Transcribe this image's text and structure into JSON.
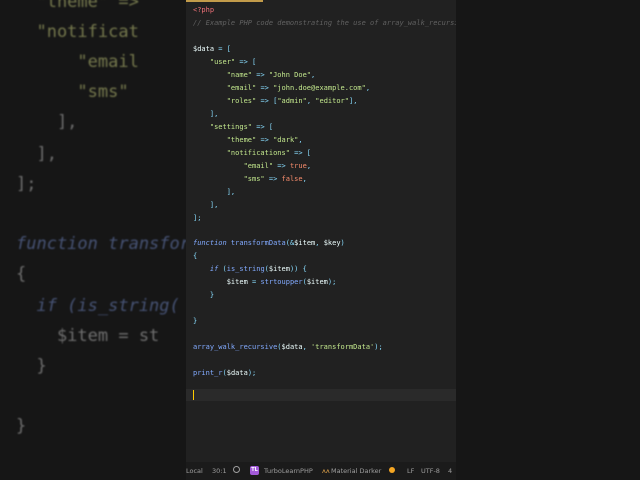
{
  "background_code": [
    {
      "text": "  \"theme\" =>",
      "cls": "bgstr"
    },
    {
      "text": "  \"notificat",
      "cls": "bgstr"
    },
    {
      "text": "      \"email",
      "cls": "bgstr"
    },
    {
      "text": "      \"sms\"",
      "cls": "bgstr"
    },
    {
      "text": "    ],",
      "cls": "bgpl"
    },
    {
      "text": "  ],",
      "cls": "bgpl"
    },
    {
      "text": "];",
      "cls": "bgpl"
    },
    {
      "text": "function transform",
      "cls": "bgkw"
    },
    {
      "text": "{",
      "cls": "bgpl"
    },
    {
      "text": "  if (is_string(",
      "cls": "bgkw"
    },
    {
      "text": "    $item = st",
      "cls": "bgvar"
    },
    {
      "text": "  }",
      "cls": "bgpl"
    },
    {
      "text": "}",
      "cls": "bgpl"
    }
  ],
  "editor": {
    "lines": [
      [
        {
          "t": "<?php",
          "c": "tag"
        }
      ],
      [
        {
          "t": "// Example PHP code demonstrating the use of array_walk_recursive",
          "c": "c"
        }
      ],
      [],
      [
        {
          "t": "$data",
          "c": "v"
        },
        {
          "t": " = [",
          "c": "p"
        }
      ],
      [
        {
          "t": "    ",
          "c": "v"
        },
        {
          "t": "\"user\"",
          "c": "s"
        },
        {
          "t": " => [",
          "c": "p"
        }
      ],
      [
        {
          "t": "        ",
          "c": "v"
        },
        {
          "t": "\"name\"",
          "c": "s"
        },
        {
          "t": " => ",
          "c": "p"
        },
        {
          "t": "\"John Doe\"",
          "c": "s"
        },
        {
          "t": ",",
          "c": "p"
        }
      ],
      [
        {
          "t": "        ",
          "c": "v"
        },
        {
          "t": "\"email\"",
          "c": "s"
        },
        {
          "t": " => ",
          "c": "p"
        },
        {
          "t": "\"john.doe@example.com\"",
          "c": "s"
        },
        {
          "t": ",",
          "c": "p"
        }
      ],
      [
        {
          "t": "        ",
          "c": "v"
        },
        {
          "t": "\"roles\"",
          "c": "s"
        },
        {
          "t": " => [",
          "c": "p"
        },
        {
          "t": "\"admin\"",
          "c": "s"
        },
        {
          "t": ", ",
          "c": "p"
        },
        {
          "t": "\"editor\"",
          "c": "s"
        },
        {
          "t": "],",
          "c": "p"
        }
      ],
      [
        {
          "t": "    ],",
          "c": "p"
        }
      ],
      [
        {
          "t": "    ",
          "c": "v"
        },
        {
          "t": "\"settings\"",
          "c": "s"
        },
        {
          "t": " => [",
          "c": "p"
        }
      ],
      [
        {
          "t": "        ",
          "c": "v"
        },
        {
          "t": "\"theme\"",
          "c": "s"
        },
        {
          "t": " => ",
          "c": "p"
        },
        {
          "t": "\"dark\"",
          "c": "s"
        },
        {
          "t": ",",
          "c": "p"
        }
      ],
      [
        {
          "t": "        ",
          "c": "v"
        },
        {
          "t": "\"notifications\"",
          "c": "s"
        },
        {
          "t": " => [",
          "c": "p"
        }
      ],
      [
        {
          "t": "            ",
          "c": "v"
        },
        {
          "t": "\"email\"",
          "c": "s"
        },
        {
          "t": " => ",
          "c": "p"
        },
        {
          "t": "true",
          "c": "t"
        },
        {
          "t": ",",
          "c": "p"
        }
      ],
      [
        {
          "t": "            ",
          "c": "v"
        },
        {
          "t": "\"sms\"",
          "c": "s"
        },
        {
          "t": " => ",
          "c": "p"
        },
        {
          "t": "false",
          "c": "t"
        },
        {
          "t": ",",
          "c": "p"
        }
      ],
      [
        {
          "t": "        ],",
          "c": "p"
        }
      ],
      [
        {
          "t": "    ],",
          "c": "p"
        }
      ],
      [
        {
          "t": "];",
          "c": "p"
        }
      ],
      [],
      [
        {
          "t": "function",
          "c": "k"
        },
        {
          "t": " transformData",
          "c": "f"
        },
        {
          "t": "(&",
          "c": "p"
        },
        {
          "t": "$item",
          "c": "v"
        },
        {
          "t": ", ",
          "c": "p"
        },
        {
          "t": "$key",
          "c": "v"
        },
        {
          "t": ")",
          "c": "p"
        }
      ],
      [
        {
          "t": "{",
          "c": "p"
        }
      ],
      [
        {
          "t": "    ",
          "c": "v"
        },
        {
          "t": "if",
          "c": "k"
        },
        {
          "t": " (",
          "c": "p"
        },
        {
          "t": "is_string",
          "c": "f"
        },
        {
          "t": "(",
          "c": "p"
        },
        {
          "t": "$item",
          "c": "v"
        },
        {
          "t": ")) {",
          "c": "p"
        }
      ],
      [
        {
          "t": "        ",
          "c": "v"
        },
        {
          "t": "$item",
          "c": "v"
        },
        {
          "t": " = ",
          "c": "p"
        },
        {
          "t": "strtoupper",
          "c": "f"
        },
        {
          "t": "(",
          "c": "p"
        },
        {
          "t": "$item",
          "c": "v"
        },
        {
          "t": ");",
          "c": "p"
        }
      ],
      [
        {
          "t": "    }",
          "c": "p"
        }
      ],
      [],
      [
        {
          "t": "}",
          "c": "p"
        }
      ],
      [],
      [
        {
          "t": "array_walk_recursive",
          "c": "f"
        },
        {
          "t": "(",
          "c": "p"
        },
        {
          "t": "$data",
          "c": "v"
        },
        {
          "t": ", ",
          "c": "p"
        },
        {
          "t": "'transformData'",
          "c": "s"
        },
        {
          "t": ");",
          "c": "p"
        }
      ],
      [],
      [
        {
          "t": "print_r",
          "c": "f"
        },
        {
          "t": "(",
          "c": "p"
        },
        {
          "t": "$data",
          "c": "v"
        },
        {
          "t": ");",
          "c": "p"
        }
      ]
    ]
  },
  "status_bar": {
    "branch": "Local",
    "position": "30:1",
    "plugin": "TurboLearnPHP",
    "plugin_badge": "TL",
    "theme": "Material Darker",
    "encoding_line": "LF",
    "encoding": "UTF-8",
    "indent": "4"
  }
}
